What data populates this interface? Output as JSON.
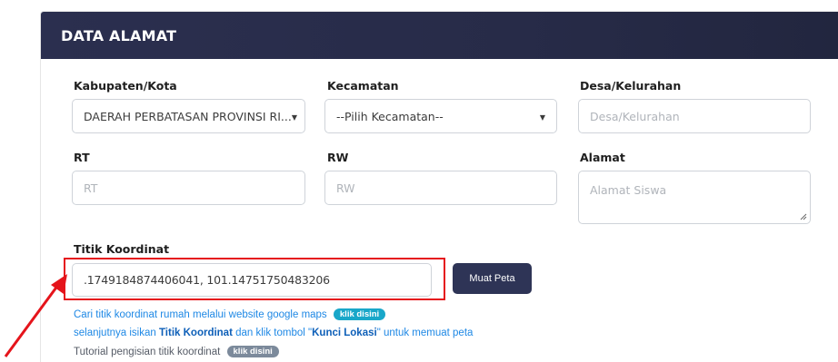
{
  "colors": {
    "header_bg": "#2b2f4f",
    "highlight": "#e5141b",
    "button_bg": "#2e3456",
    "link_blue": "#1e88e5",
    "pill_teal": "#19a7c9",
    "pill_gray": "#7c8a9b"
  },
  "card": {
    "title": "DATA ALAMAT"
  },
  "fields": {
    "kabupaten": {
      "label": "Kabupaten/Kota",
      "value": "DAERAH PERBATASAN PROVINSI RI..."
    },
    "kecamatan": {
      "label": "Kecamatan",
      "value": "--Pilih Kecamatan--"
    },
    "desa": {
      "label": "Desa/Kelurahan",
      "placeholder": "Desa/Kelurahan"
    },
    "rt": {
      "label": "RT",
      "placeholder": "RT"
    },
    "rw": {
      "label": "RW",
      "placeholder": "RW"
    },
    "alamat": {
      "label": "Alamat",
      "placeholder": "Alamat Siswa"
    },
    "koordinat": {
      "label": "Titik Koordinat",
      "value": ".1749184874406041, 101.14751750483206"
    }
  },
  "buttons": {
    "muat_peta": "Muat Peta"
  },
  "help": {
    "line1_text": "Cari titik koordinat rumah melalui website google maps",
    "line1_pill": "klik disini",
    "line2_pre": "selanjutnya isikan ",
    "line2_b1": "Titik Koordinat",
    "line2_mid": " dan klik tombol \"",
    "line2_b2": "Kunci Lokasi",
    "line2_post": "\" untuk memuat peta",
    "line3_text": "Tutorial pengisian titik koordinat",
    "line3_pill": "klik disini"
  },
  "icons": {
    "caret": "caret-down-icon",
    "arrow": "red-arrow-annotation-icon",
    "grip": "resize-grip-icon"
  }
}
